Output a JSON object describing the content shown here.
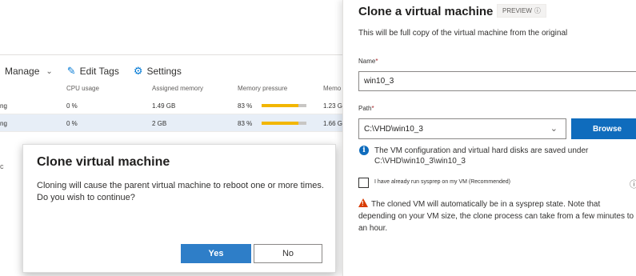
{
  "background": {
    "toolbar": {
      "manage": "Manage",
      "edit_tags": "Edit Tags",
      "settings": "Settings"
    },
    "columns": [
      "CPU usage",
      "Assigned memory",
      "Memory pressure",
      "Memo"
    ],
    "rows": [
      {
        "state": "ng",
        "cpu": "0 %",
        "memory": "1.49 GB",
        "pressure": "83 %",
        "pressure_value": 83,
        "demand": "1.23 G"
      },
      {
        "state": "ng",
        "cpu": "0 %",
        "memory": "2 GB",
        "pressure": "83 %",
        "pressure_value": 83,
        "demand": "1.66 G"
      }
    ],
    "stray_char": "c"
  },
  "dialog": {
    "title": "Clone virtual machine",
    "message_line1": "Cloning will cause the parent virtual machine to reboot one or more times.",
    "message_line2": "Do you wish to continue?",
    "yes_label": "Yes",
    "no_label": "No"
  },
  "pane": {
    "title": "Clone a virtual machine",
    "badge": "PREVIEW",
    "description": "This will be full copy of the virtual machine from the original",
    "name_label": "Name",
    "name_value": "win10_3",
    "path_label": "Path",
    "path_value": "C:\\VHD\\win10_3",
    "browse_label": "Browse",
    "info_line1": "The VM configuration and virtual hard disks are saved under",
    "info_line2": "C:\\VHD\\win10_3\\win10_3",
    "checkbox_label": "I have already run sysprep on my VM (Recommended)",
    "checkbox_checked": false,
    "warning_text": "The cloned VM will automatically be in a sysprep state. Note that depending on your VM size, the clone process can take from a few minutes to an hour.",
    "required_marker": "*"
  },
  "colors": {
    "accent": "#0f6cbd",
    "pressure_bar": "#f2b600",
    "warning": "#d83b01"
  },
  "icons": [
    "chevron-down-icon",
    "edit-tags-icon",
    "settings-gear-icon",
    "info-icon",
    "warning-icon"
  ]
}
